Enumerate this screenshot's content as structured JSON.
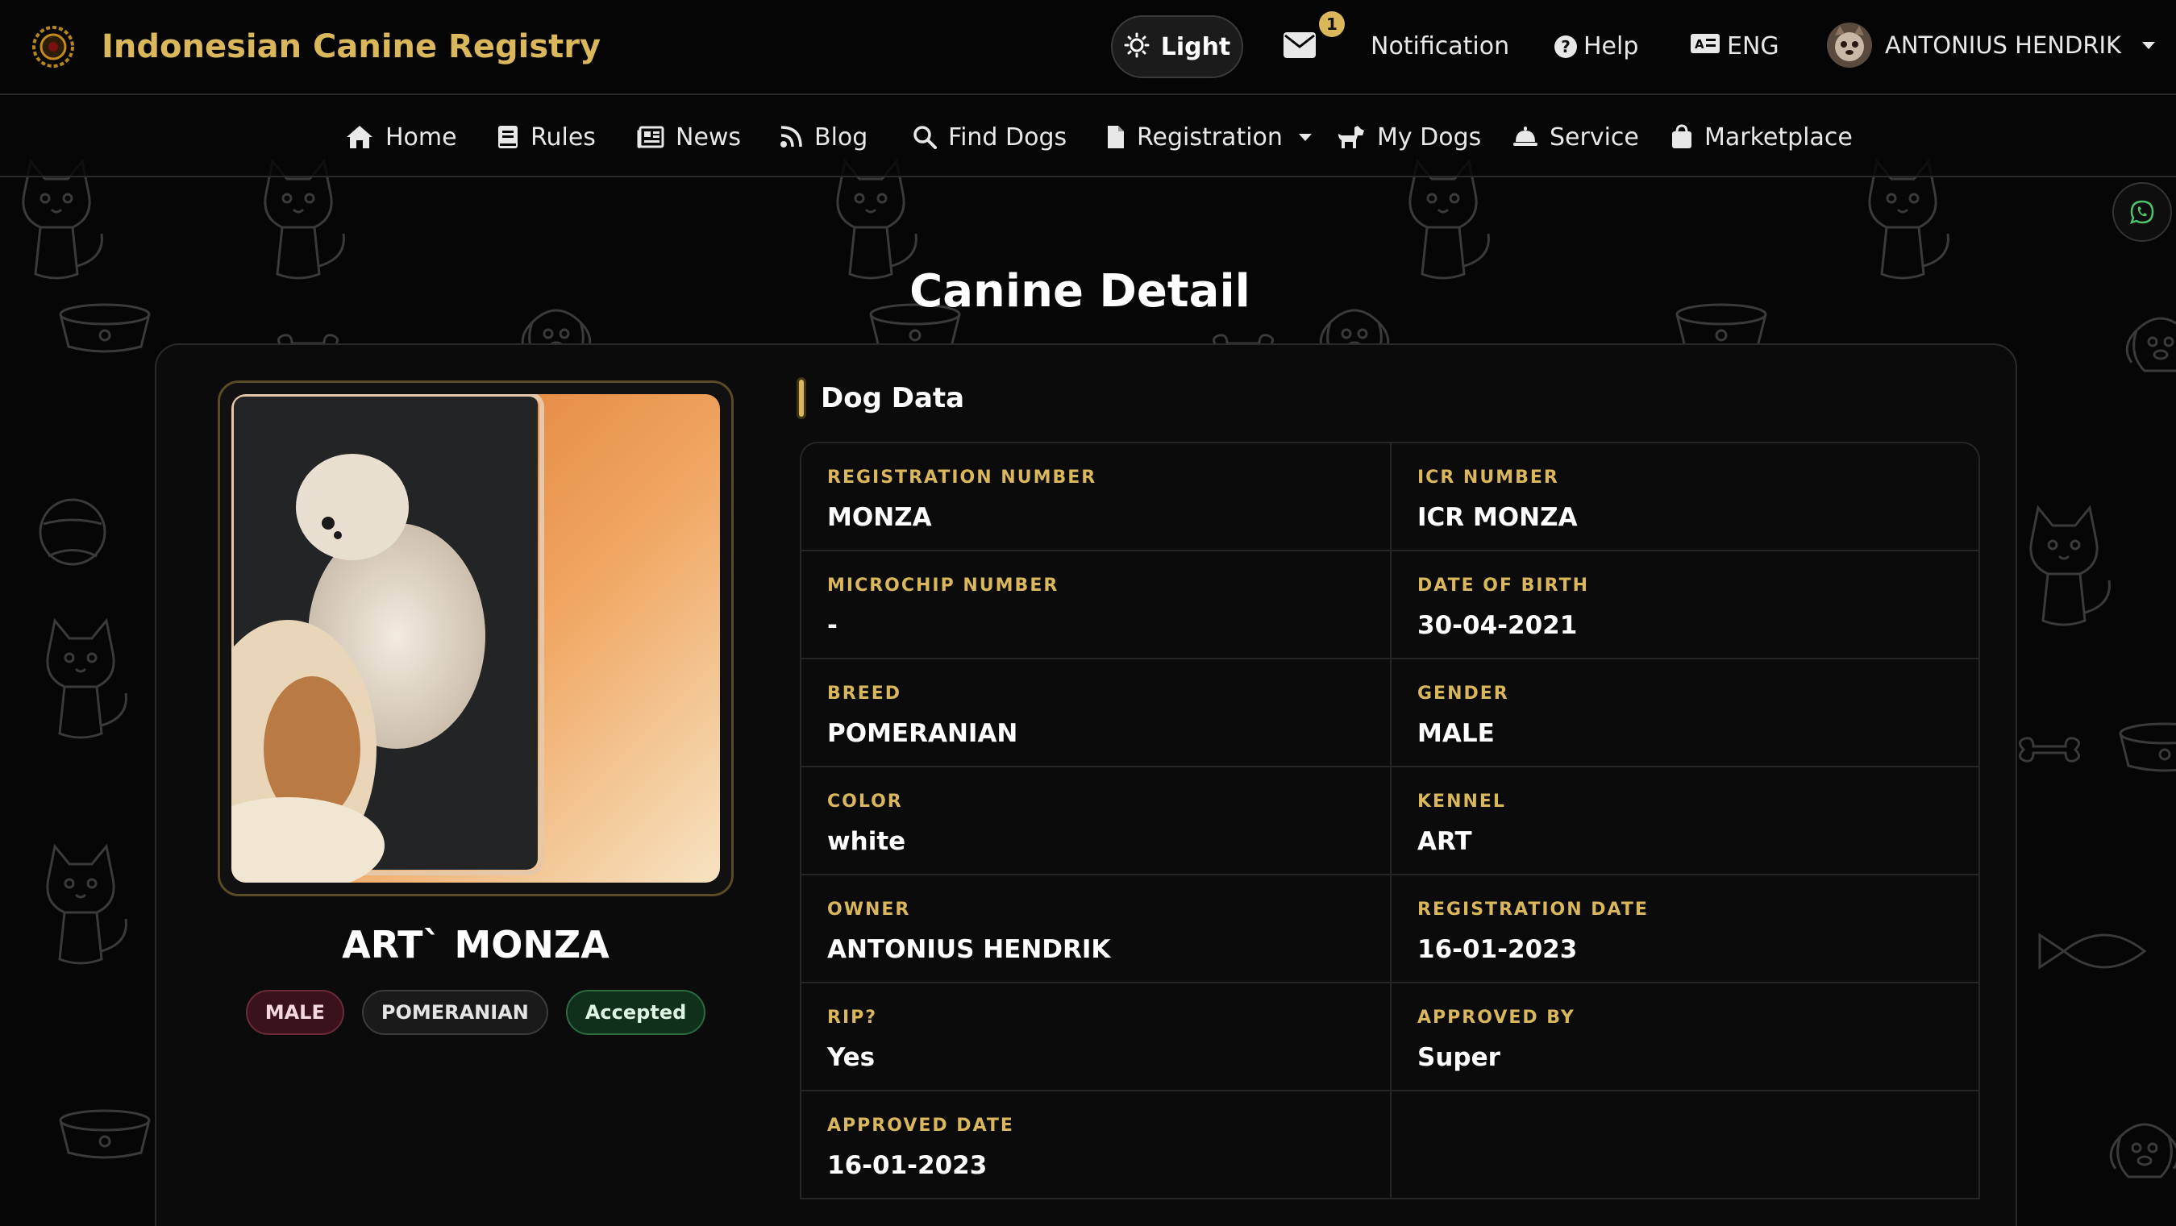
{
  "header": {
    "brand": "Indonesian Canine Registry",
    "theme_label": "Light",
    "mail_count": "1",
    "notification_label": "Notification",
    "help_label": "Help",
    "language_label": "ENG",
    "user_name": "ANTONIUS HENDRIK"
  },
  "nav": {
    "items": [
      {
        "label": "Home",
        "icon": "home-icon"
      },
      {
        "label": "Rules",
        "icon": "book-icon"
      },
      {
        "label": "News",
        "icon": "newspaper-icon"
      },
      {
        "label": "Blog",
        "icon": "rss-icon"
      },
      {
        "label": "Find Dogs",
        "icon": "search-icon"
      },
      {
        "label": "Registration",
        "icon": "document-icon"
      },
      {
        "label": "My Dogs",
        "icon": "dog-icon"
      },
      {
        "label": "Service",
        "icon": "bell-icon"
      },
      {
        "label": "Marketplace",
        "icon": "shopping-bag-icon"
      }
    ]
  },
  "page": {
    "title": "Canine Detail"
  },
  "dog": {
    "name": "ART` MONZA",
    "badges": {
      "gender": "MALE",
      "breed": "POMERANIAN",
      "status": "Accepted"
    },
    "section_title": "Dog Data",
    "fields": {
      "registration_number": {
        "label": "REGISTRATION NUMBER",
        "value": "MONZA"
      },
      "icr_number": {
        "label": "ICR NUMBER",
        "value": "ICR MONZA"
      },
      "microchip_number": {
        "label": "MICROCHIP NUMBER",
        "value": "-"
      },
      "date_of_birth": {
        "label": "DATE OF BIRTH",
        "value": "30-04-2021"
      },
      "breed": {
        "label": "BREED",
        "value": "POMERANIAN"
      },
      "gender": {
        "label": "GENDER",
        "value": "MALE"
      },
      "color": {
        "label": "COLOR",
        "value": "white"
      },
      "kennel": {
        "label": "KENNEL",
        "value": "ART"
      },
      "owner": {
        "label": "OWNER",
        "value": "ANTONIUS HENDRIK"
      },
      "registration_date": {
        "label": "REGISTRATION DATE",
        "value": "16-01-2023"
      },
      "rip": {
        "label": "RIP?",
        "value": "Yes"
      },
      "approved_by": {
        "label": "APPROVED BY",
        "value": "Super"
      },
      "approved_date": {
        "label": "APPROVED DATE",
        "value": "16-01-2023"
      }
    }
  },
  "colors": {
    "accent_gold": "#d9b75a",
    "background": "#060606",
    "card": "#0b0b0b"
  }
}
